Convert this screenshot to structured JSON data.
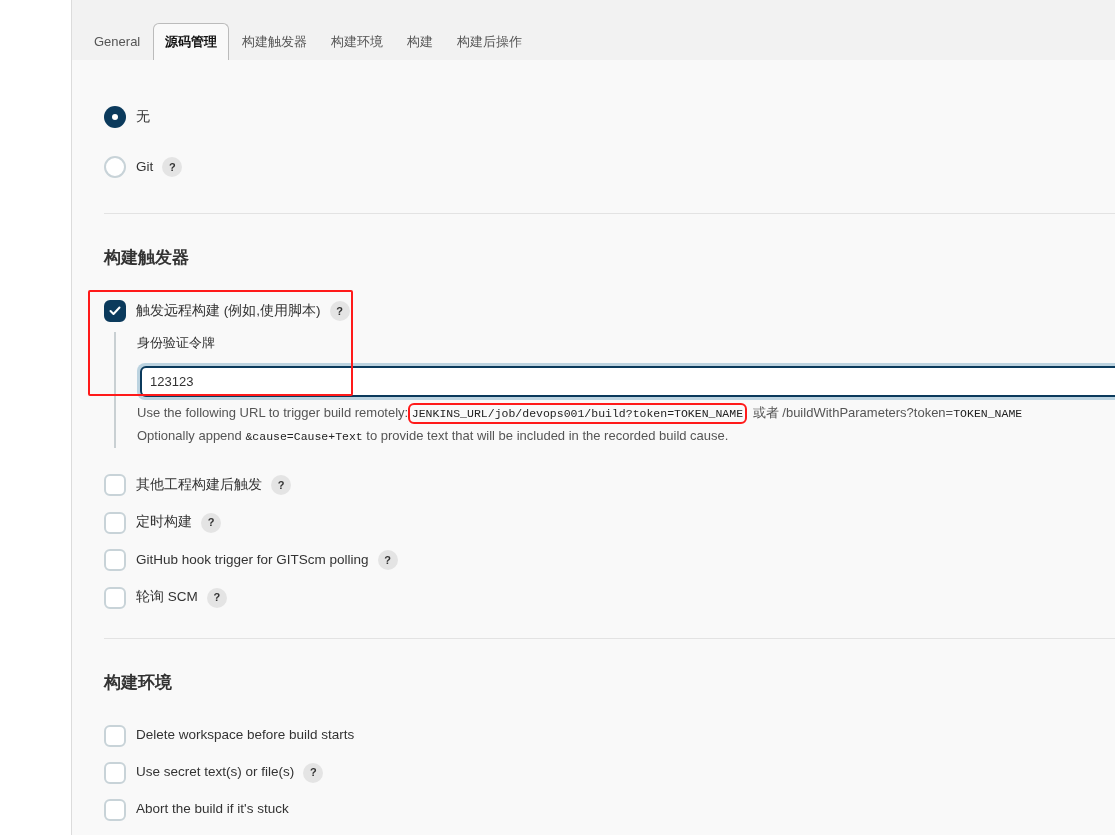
{
  "tabs": [
    {
      "label": "General",
      "selected": false
    },
    {
      "label": "源码管理",
      "selected": true
    },
    {
      "label": "构建触发器",
      "selected": false
    },
    {
      "label": "构建环境",
      "selected": false
    },
    {
      "label": "构建",
      "selected": false
    },
    {
      "label": "构建后操作",
      "selected": false
    }
  ],
  "scm": {
    "options": [
      {
        "label": "无",
        "selected": true
      },
      {
        "label": "Git",
        "selected": false,
        "help": "?"
      }
    ]
  },
  "triggers": {
    "title": "构建触发器",
    "items": [
      {
        "label": "触发远程构建 (例如,使用脚本)",
        "checked": true,
        "help": "?",
        "token_label": "身份验证令牌",
        "token_value": "123123",
        "url_help": [
          {
            "kind": "text",
            "text": "Use the following URL to trigger build remotely: "
          },
          {
            "kind": "code",
            "text": "JENKINS_URL/job/devops001/build?token=TOKEN_NAME",
            "highlighted": true
          },
          {
            "kind": "text",
            "text": " 或者 /buildWithParameters?token="
          },
          {
            "kind": "code",
            "text": "TOKEN_NAME"
          }
        ],
        "cause_help": [
          {
            "kind": "text",
            "text": "Optionally append "
          },
          {
            "kind": "code",
            "text": "&cause=Cause+Text"
          },
          {
            "kind": "text",
            "text": " to provide text that will be included in the recorded build cause."
          }
        ]
      },
      {
        "label": "其他工程构建后触发",
        "checked": false,
        "help": "?"
      },
      {
        "label": "定时构建",
        "checked": false,
        "help": "?"
      },
      {
        "label": "GitHub hook trigger for GITScm polling",
        "checked": false,
        "help": "?"
      },
      {
        "label": "轮询 SCM",
        "checked": false,
        "help": "?"
      }
    ]
  },
  "environment": {
    "title": "构建环境",
    "items": [
      {
        "label": "Delete workspace before build starts",
        "checked": false
      },
      {
        "label": "Use secret text(s) or file(s)",
        "checked": false,
        "help": "?"
      },
      {
        "label": "Abort the build if it's stuck",
        "checked": false
      }
    ]
  }
}
